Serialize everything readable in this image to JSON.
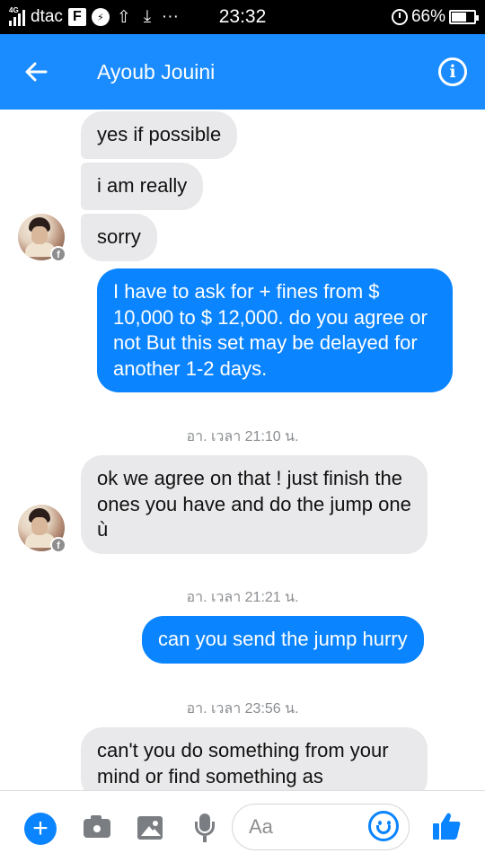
{
  "status_bar": {
    "network_tag": "4G",
    "carrier": "dtac",
    "fb_icon": "F",
    "more": "···",
    "time": "23:32",
    "battery_percent": "66%",
    "battery_level": 0.66
  },
  "header": {
    "title": "Ayoub Jouini",
    "back_icon": "arrow-left-icon",
    "info_icon": "info-icon",
    "info_glyph": "i"
  },
  "messages": {
    "in_1": "yes if possible",
    "in_2": "i am really",
    "in_3": "sorry",
    "out_1": "I have to ask for + fines from $ 10,000 to $ 12,000. do you agree or not But this set may be delayed for another 1-2 days.",
    "ts_1": "อา. เวลา 21:10 น.",
    "in_4": "ok we agree on that ! just finish the ones you have and do the jump one ù",
    "ts_2": "อา. เวลา 21:21 น.",
    "out_2": "can you send the jump hurry",
    "ts_3": "อา. เวลา 23:56 น.",
    "in_5": "can't you do something from your mind or find something as"
  },
  "composer": {
    "placeholder": "Aa",
    "plus_glyph": "+"
  },
  "colors": {
    "accent": "#0a84ff",
    "header_bg": "#1a8cff",
    "incoming_bubble": "#e9e9eb",
    "icon_gray": "#7a7d82"
  }
}
